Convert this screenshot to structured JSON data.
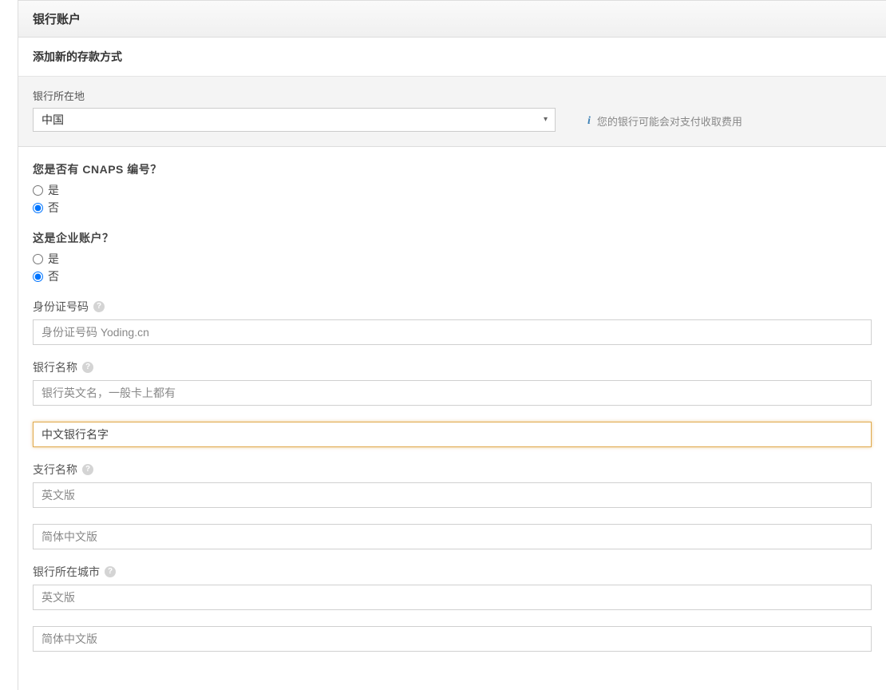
{
  "header": {
    "title": "银行账户",
    "subtitle": "添加新的存款方式"
  },
  "location": {
    "label": "银行所在地",
    "value": "中国",
    "info": "您的银行可能会对支付收取费用"
  },
  "cnaps": {
    "question": "您是否有 CNAPS 编号？",
    "yes": "是",
    "no": "否",
    "selected": "no"
  },
  "corporate": {
    "question": "这是企业账户？",
    "yes": "是",
    "no": "否",
    "selected": "no"
  },
  "id_number": {
    "label": "身份证号码",
    "placeholder": "身份证号码 Yoding.cn"
  },
  "bank_name": {
    "label": "银行名称",
    "placeholder_en": "银行英文名，一般卡上都有",
    "value_cn": "中文银行名字"
  },
  "branch_name": {
    "label": "支行名称",
    "placeholder_en": "英文版",
    "placeholder_cn": "简体中文版"
  },
  "bank_city": {
    "label": "银行所在城市",
    "placeholder_en": "英文版",
    "placeholder_cn": "简体中文版"
  }
}
